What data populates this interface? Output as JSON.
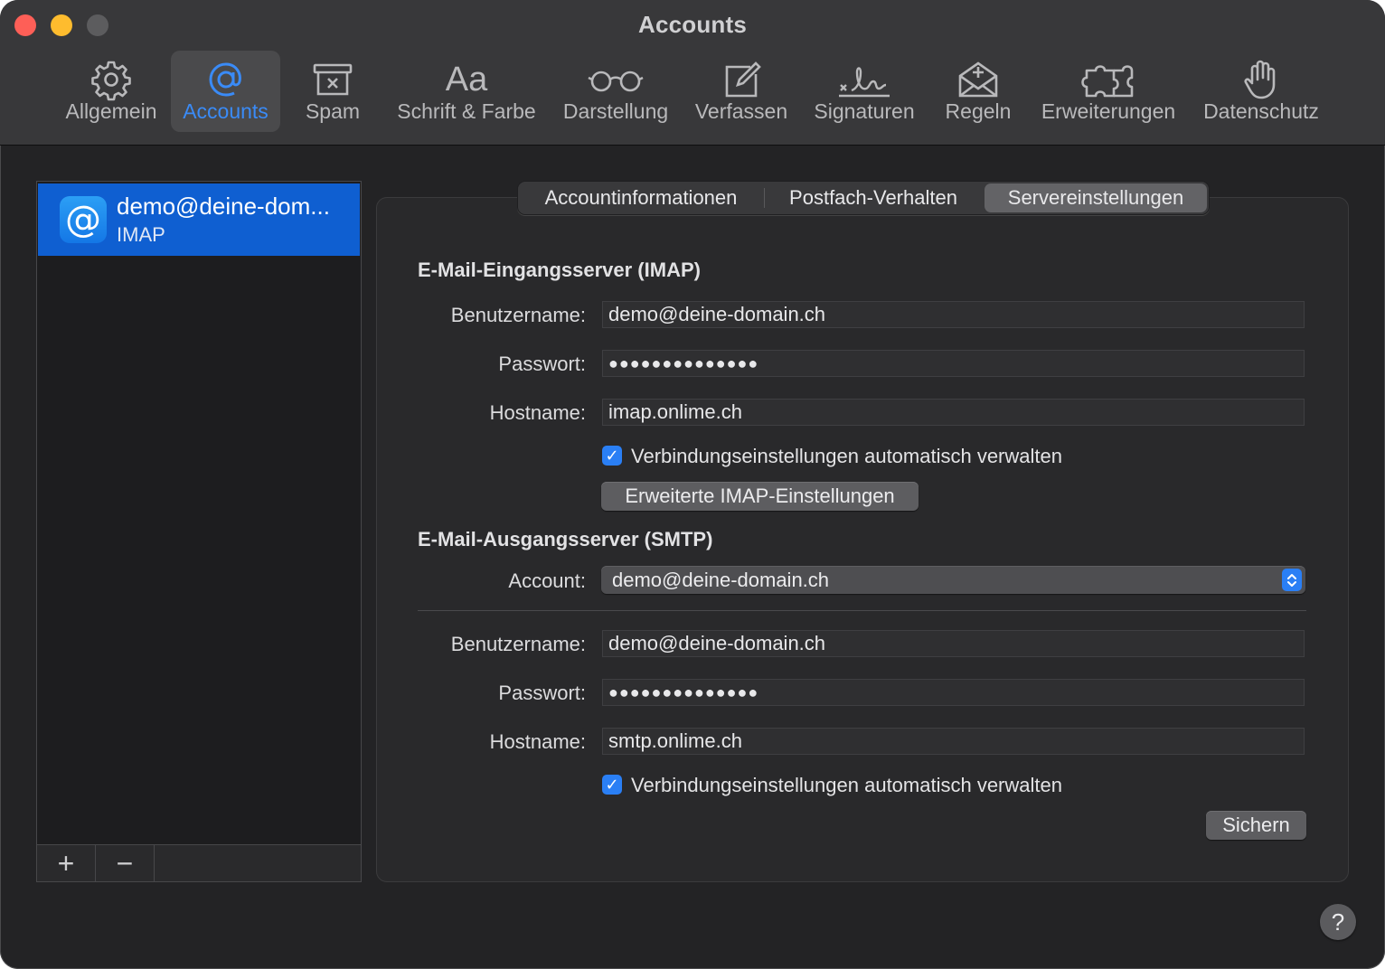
{
  "window": {
    "title": "Accounts"
  },
  "toolbar": {
    "items": [
      {
        "label": "Allgemein",
        "icon": "gear-icon"
      },
      {
        "label": "Accounts",
        "icon": "at-icon",
        "active": true
      },
      {
        "label": "Spam",
        "icon": "junk-tray-icon"
      },
      {
        "label": "Schrift & Farbe",
        "icon": "font-icon",
        "glyph": "Aa"
      },
      {
        "label": "Darstellung",
        "icon": "glasses-icon"
      },
      {
        "label": "Verfassen",
        "icon": "compose-icon"
      },
      {
        "label": "Signaturen",
        "icon": "signature-icon"
      },
      {
        "label": "Regeln",
        "icon": "rules-envelope-icon"
      },
      {
        "label": "Erweiterungen",
        "icon": "puzzle-icon"
      },
      {
        "label": "Datenschutz",
        "icon": "hand-icon"
      }
    ]
  },
  "accounts": {
    "list": [
      {
        "name": "demo@deine-dom...",
        "type": "IMAP",
        "avatar": "@",
        "selected": true
      }
    ],
    "add_label": "+",
    "remove_label": "−"
  },
  "tabs": [
    {
      "label": "Accountinformationen"
    },
    {
      "label": "Postfach-Verhalten"
    },
    {
      "label": "Servereinstellungen",
      "active": true
    }
  ],
  "incoming": {
    "title": "E-Mail-Eingangsserver (IMAP)",
    "username_label": "Benutzername:",
    "username": "demo@deine-domain.ch",
    "password_label": "Passwort:",
    "password": "●●●●●●●●●●●●●●",
    "hostname_label": "Hostname:",
    "hostname": "imap.onlime.ch",
    "auto_manage_label": "Verbindungseinstellungen automatisch verwalten",
    "auto_manage_checked": true,
    "advanced_button": "Erweiterte IMAP-Einstellungen"
  },
  "outgoing": {
    "title": "E-Mail-Ausgangsserver (SMTP)",
    "account_label": "Account:",
    "account_value": "demo@deine-domain.ch",
    "username_label": "Benutzername:",
    "username": "demo@deine-domain.ch",
    "password_label": "Passwort:",
    "password": "●●●●●●●●●●●●●●",
    "hostname_label": "Hostname:",
    "hostname": "smtp.onlime.ch",
    "auto_manage_label": "Verbindungseinstellungen automatisch verwalten",
    "auto_manage_checked": true
  },
  "save_button": "Sichern",
  "help_button": "?",
  "colors": {
    "accent": "#2a7ff5",
    "selection": "#0f5fd1",
    "close": "#fe5f57",
    "minimize": "#febc2e"
  }
}
